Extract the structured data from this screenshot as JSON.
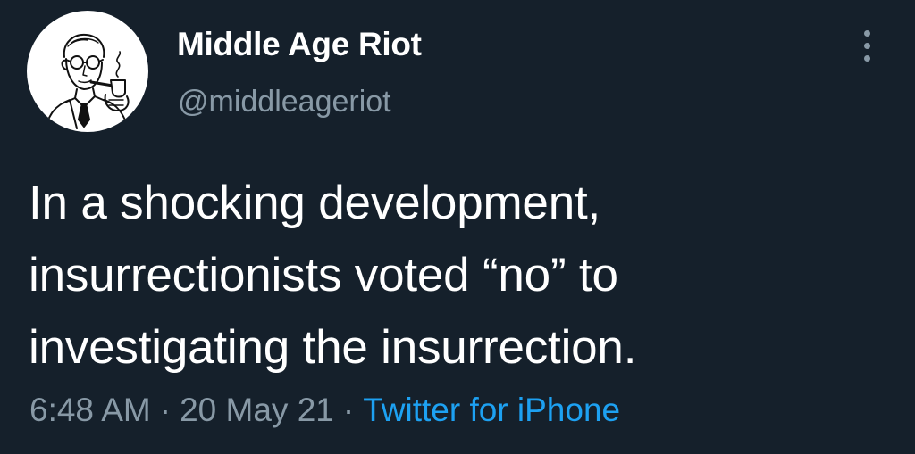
{
  "author": {
    "display_name": "Middle Age Riot",
    "handle": "@middleageriot",
    "avatar_icon": "vintage-man-with-pipe-illustration"
  },
  "menu": {
    "icon": "more-vertical-icon"
  },
  "tweet": {
    "text_lines": [
      "In a shocking development,",
      "insurrectionists voted “no” to",
      "investigating the insurrection."
    ]
  },
  "meta": {
    "time": "6:48 AM",
    "separator": "·",
    "date": "20 May 21",
    "source": "Twitter for iPhone"
  },
  "colors": {
    "background": "#15202b",
    "primary_text": "#ffffff",
    "secondary_text": "#8899a6",
    "link": "#1da1f2"
  }
}
